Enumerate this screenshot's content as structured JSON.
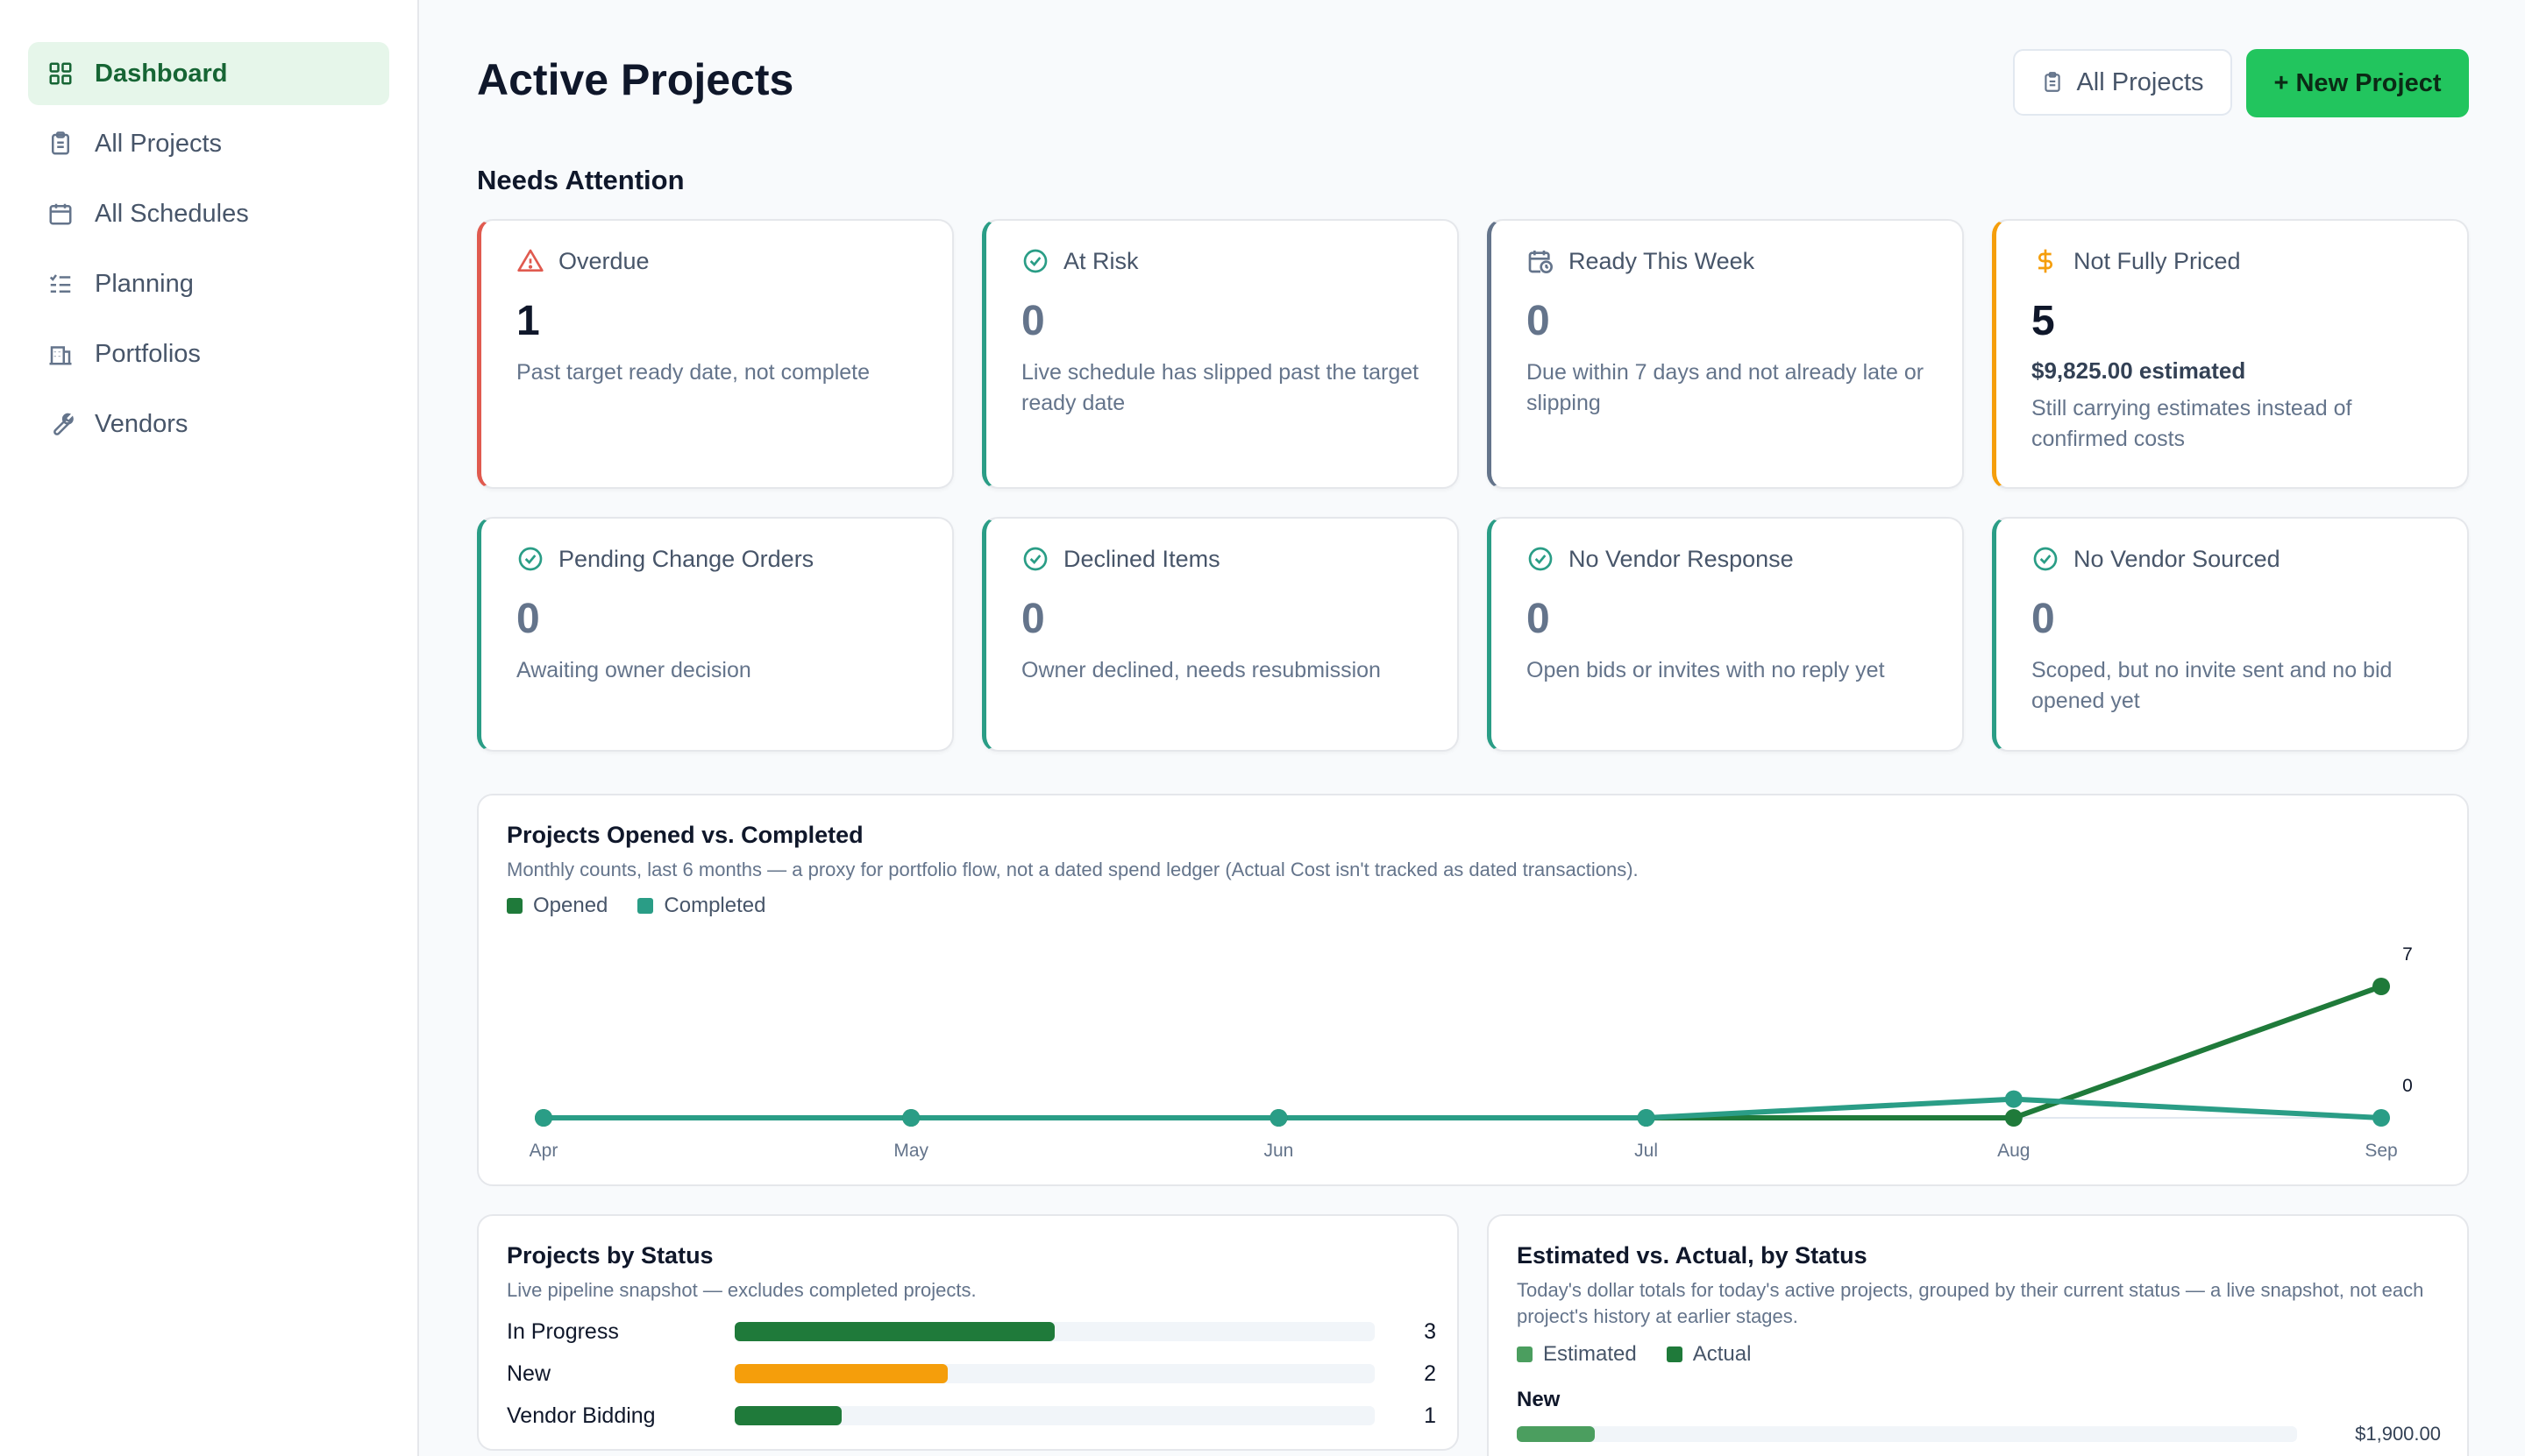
{
  "sidebar": {
    "items": [
      {
        "label": "Dashboard",
        "icon": "grid-icon",
        "active": true
      },
      {
        "label": "All Projects",
        "icon": "clipboard-icon"
      },
      {
        "label": "All Schedules",
        "icon": "calendar-icon"
      },
      {
        "label": "Planning",
        "icon": "list-checks-icon"
      },
      {
        "label": "Portfolios",
        "icon": "building-icon"
      },
      {
        "label": "Vendors",
        "icon": "wrench-icon"
      }
    ]
  },
  "header": {
    "title": "Active Projects",
    "all_projects_label": "All Projects",
    "new_project_label": "+ New Project"
  },
  "attention": {
    "title": "Needs Attention",
    "cards": [
      {
        "title": "Overdue",
        "value": "1",
        "desc": "Past target ready date, not complete",
        "accent": "#e05a4f",
        "icon": "alert-triangle-icon"
      },
      {
        "title": "At Risk",
        "value": "0",
        "desc": "Live schedule has slipped past the target ready date",
        "accent": "#2a9d86",
        "icon": "check-circle-icon"
      },
      {
        "title": "Ready This Week",
        "value": "0",
        "desc": "Due within 7 days and not already late or slipping",
        "accent": "#64748b",
        "icon": "calendar-clock-icon"
      },
      {
        "title": "Not Fully Priced",
        "value": "5",
        "sub": "$9,825.00 estimated",
        "desc": "Still carrying estimates instead of confirmed costs",
        "accent": "#f59e0b",
        "icon": "dollar-icon"
      },
      {
        "title": "Pending Change Orders",
        "value": "0",
        "desc": "Awaiting owner decision",
        "accent": "#2a9d86",
        "icon": "check-circle-icon"
      },
      {
        "title": "Declined Items",
        "value": "0",
        "desc": "Owner declined, needs resubmission",
        "accent": "#2a9d86",
        "icon": "check-circle-icon"
      },
      {
        "title": "No Vendor Response",
        "value": "0",
        "desc": "Open bids or invites with no reply yet",
        "accent": "#2a9d86",
        "icon": "check-circle-icon"
      },
      {
        "title": "No Vendor Sourced",
        "value": "0",
        "desc": "Scoped, but no invite sent and no bid opened yet",
        "accent": "#2a9d86",
        "icon": "check-circle-icon"
      }
    ]
  },
  "flow_panel": {
    "title": "Projects Opened vs. Completed",
    "subtitle": "Monthly counts, last 6 months — a proxy for portfolio flow, not a dated spend ledger (Actual Cost isn't tracked as dated transactions).",
    "legend_opened": "Opened",
    "legend_completed": "Completed"
  },
  "chart_data": {
    "type": "line",
    "title": "Projects Opened vs. Completed",
    "x": [
      "Apr",
      "May",
      "Jun",
      "Jul",
      "Aug",
      "Sep"
    ],
    "series": [
      {
        "name": "Opened",
        "values": [
          0,
          0,
          0,
          0,
          0,
          7
        ],
        "color": "#1f7a3a"
      },
      {
        "name": "Completed",
        "values": [
          0,
          0,
          0,
          0,
          1,
          0
        ],
        "color": "#2a9d86"
      }
    ],
    "end_labels": [
      "7",
      "0"
    ],
    "ylim": [
      0,
      7
    ],
    "grid": false,
    "legend": "top-left"
  },
  "status_panel": {
    "title": "Projects by Status",
    "subtitle": "Live pipeline snapshot — excludes completed projects.",
    "max": 6,
    "rows": [
      {
        "label": "In Progress",
        "count": 3,
        "count_text": "3",
        "color": "#1f7a3a"
      },
      {
        "label": "New",
        "count": 2,
        "count_text": "2",
        "color": "#f59e0b"
      },
      {
        "label": "Vendor Bidding",
        "count": 1,
        "count_text": "1",
        "color": "#1f7a3a"
      }
    ]
  },
  "est_panel": {
    "title": "Estimated vs. Actual, by Status",
    "subtitle": "Today's dollar totals for today's active projects, grouped by their current status — a live snapshot, not each project's history at earlier stages.",
    "legend_estimated": "Estimated",
    "legend_actual": "Actual",
    "estimated_color": "#4b9e5f",
    "actual_color": "#1f7a3a",
    "groups": [
      {
        "label": "New",
        "estimated_text": "$1,900.00",
        "estimated_fraction": 0.1
      }
    ]
  }
}
